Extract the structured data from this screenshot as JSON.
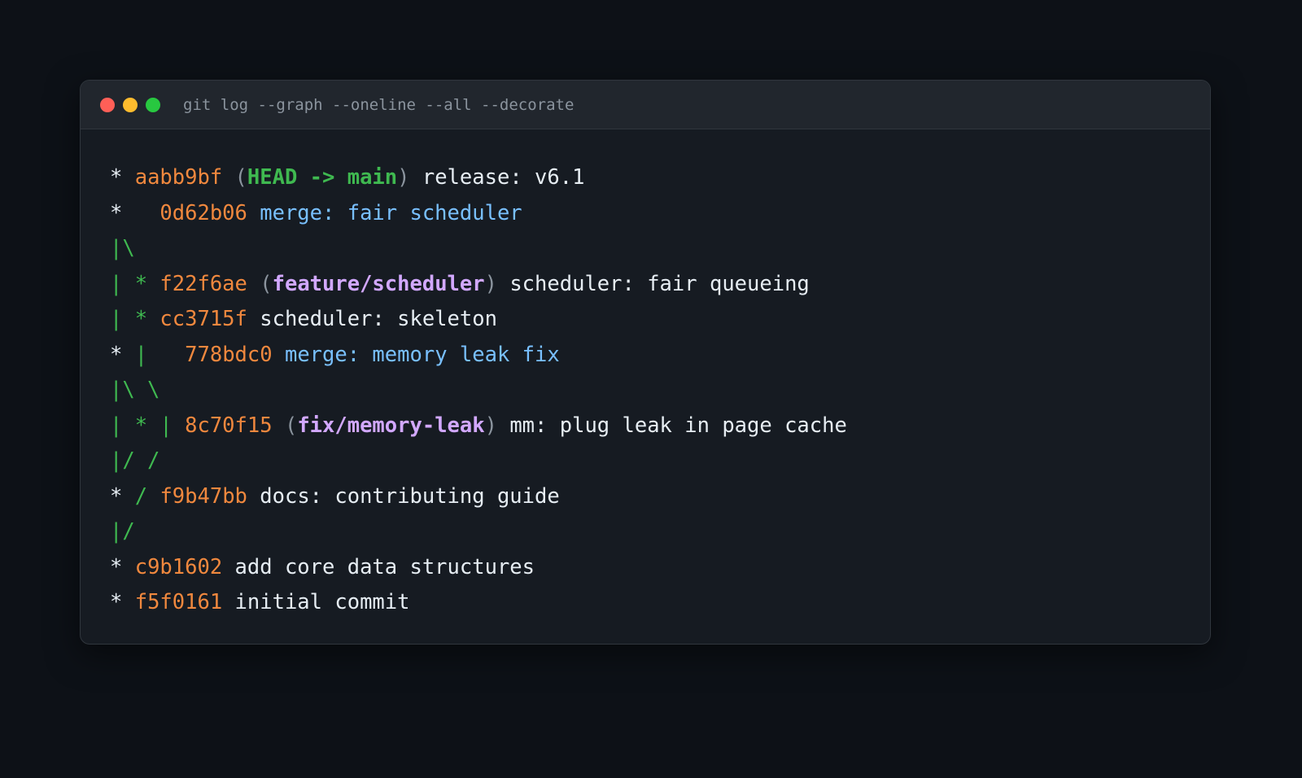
{
  "window": {
    "title": "git log --graph --oneline --all --decorate"
  },
  "log": [
    {
      "graph": [
        {
          "t": "* ",
          "c": "star"
        }
      ],
      "hash": "aabb9bf",
      "refs": "HEAD -> main",
      "ref_kind": "head",
      "message": "release: v6.1",
      "kind": "commit"
    },
    {
      "graph": [
        {
          "t": "*   ",
          "c": "star"
        }
      ],
      "hash": "0d62b06",
      "message": "merge: fair scheduler",
      "kind": "merge"
    },
    {
      "graph": [
        {
          "t": "|\\",
          "c": "branch"
        }
      ]
    },
    {
      "graph": [
        {
          "t": "| * ",
          "c": "branch"
        }
      ],
      "hash": "f22f6ae",
      "refs": "feature/scheduler",
      "ref_kind": "branch",
      "message": "scheduler: fair queueing",
      "kind": "commit"
    },
    {
      "graph": [
        {
          "t": "| * ",
          "c": "branch"
        }
      ],
      "hash": "cc3715f",
      "message": "scheduler: skeleton",
      "kind": "commit"
    },
    {
      "graph": [
        {
          "t": "* ",
          "c": "star"
        },
        {
          "t": "|   ",
          "c": "branch"
        }
      ],
      "hash": "778bdc0",
      "message": "merge: memory leak fix",
      "kind": "merge"
    },
    {
      "graph": [
        {
          "t": "|\\ \\",
          "c": "branch"
        }
      ]
    },
    {
      "graph": [
        {
          "t": "| * | ",
          "c": "branch"
        }
      ],
      "hash": "8c70f15",
      "refs": "fix/memory-leak",
      "ref_kind": "branch",
      "message": "mm: plug leak in page cache",
      "kind": "commit"
    },
    {
      "graph": [
        {
          "t": "|/ /",
          "c": "branch"
        }
      ]
    },
    {
      "graph": [
        {
          "t": "* ",
          "c": "star"
        },
        {
          "t": "/ ",
          "c": "branch"
        }
      ],
      "hash": "f9b47bb",
      "message": "docs: contributing guide",
      "kind": "commit"
    },
    {
      "graph": [
        {
          "t": "|/",
          "c": "branch"
        }
      ]
    },
    {
      "graph": [
        {
          "t": "* ",
          "c": "star"
        }
      ],
      "hash": "c9b1602",
      "message": "add core data structures",
      "kind": "commit"
    },
    {
      "graph": [
        {
          "t": "* ",
          "c": "star"
        }
      ],
      "hash": "f5f0161",
      "message": "initial commit",
      "kind": "commit"
    }
  ]
}
